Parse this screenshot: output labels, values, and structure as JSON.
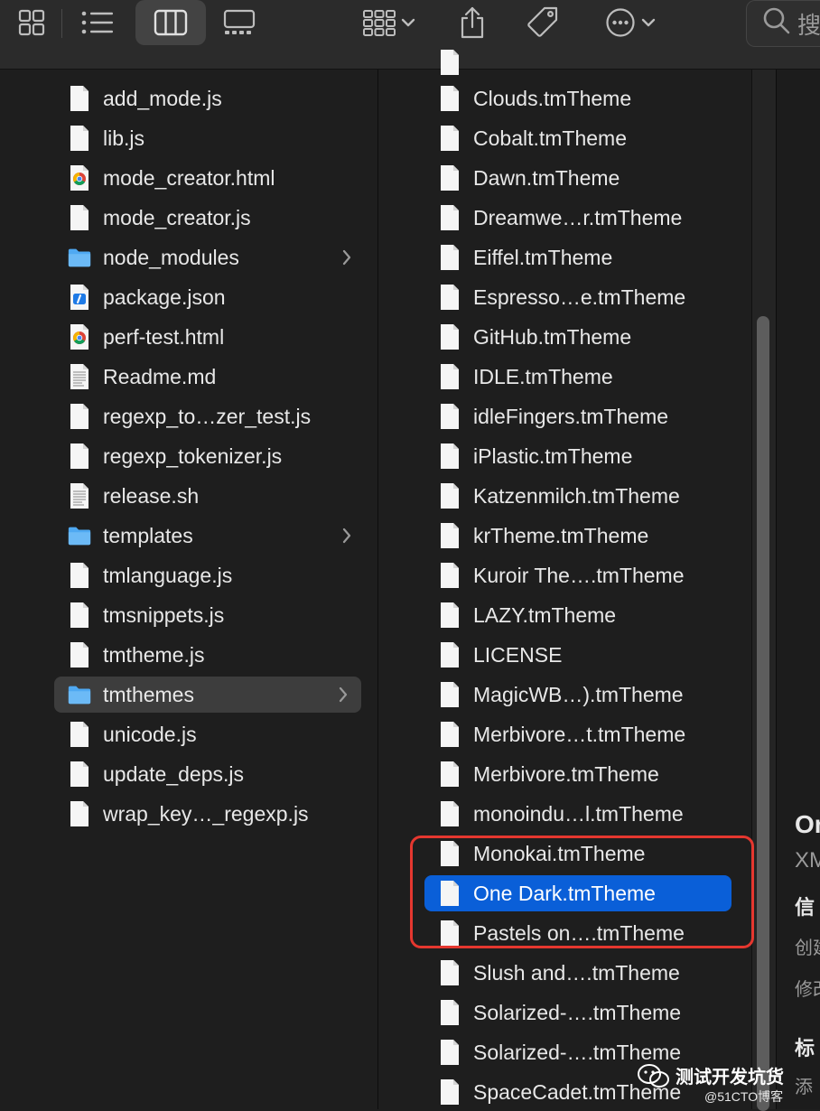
{
  "toolbar": {
    "buttons": [
      {
        "name": "icon-view-button",
        "icon": "grid-icon"
      },
      {
        "name": "list-view-button",
        "icon": "list-icon"
      },
      {
        "name": "column-view-button",
        "icon": "columns-icon",
        "selected": true
      },
      {
        "name": "gallery-view-button",
        "icon": "gallery-icon"
      },
      {
        "name": "group-button",
        "icon": "group-grid-icon"
      },
      {
        "name": "share-button",
        "icon": "share-icon"
      },
      {
        "name": "tags-button",
        "icon": "tag-icon"
      },
      {
        "name": "more-actions-button",
        "icon": "ellipsis-circle-icon"
      }
    ],
    "search_placeholder": "搜"
  },
  "column1": {
    "items": [
      {
        "label": "add_mode.js",
        "icon": "document-icon"
      },
      {
        "label": "lib.js",
        "icon": "document-icon"
      },
      {
        "label": "mode_creator.html",
        "icon": "chrome-html-icon"
      },
      {
        "label": "mode_creator.js",
        "icon": "document-icon"
      },
      {
        "label": "node_modules",
        "icon": "folder-icon",
        "folder": true
      },
      {
        "label": "package.json",
        "icon": "json-file-icon"
      },
      {
        "label": "perf-test.html",
        "icon": "chrome-html-icon"
      },
      {
        "label": "Readme.md",
        "icon": "text-document-icon"
      },
      {
        "label": "regexp_to…zer_test.js",
        "icon": "document-icon"
      },
      {
        "label": "regexp_tokenizer.js",
        "icon": "document-icon"
      },
      {
        "label": "release.sh",
        "icon": "text-document-icon"
      },
      {
        "label": "templates",
        "icon": "folder-icon",
        "folder": true
      },
      {
        "label": "tmlanguage.js",
        "icon": "document-icon"
      },
      {
        "label": "tmsnippets.js",
        "icon": "document-icon"
      },
      {
        "label": "tmtheme.js",
        "icon": "document-icon"
      },
      {
        "label": "tmthemes",
        "icon": "folder-icon",
        "folder": true,
        "selected": true
      },
      {
        "label": "unicode.js",
        "icon": "document-icon"
      },
      {
        "label": "update_deps.js",
        "icon": "document-icon"
      },
      {
        "label": "wrap_key…_regexp.js",
        "icon": "document-icon"
      }
    ]
  },
  "column2": {
    "items": [
      {
        "label": "Clouds.tmTheme"
      },
      {
        "label": "Cobalt.tmTheme"
      },
      {
        "label": "Dawn.tmTheme"
      },
      {
        "label": "Dreamwe…r.tmTheme"
      },
      {
        "label": "Eiffel.tmTheme"
      },
      {
        "label": "Espresso…e.tmTheme"
      },
      {
        "label": "GitHub.tmTheme"
      },
      {
        "label": "IDLE.tmTheme"
      },
      {
        "label": "idleFingers.tmTheme"
      },
      {
        "label": "iPlastic.tmTheme"
      },
      {
        "label": "Katzenmilch.tmTheme"
      },
      {
        "label": "krTheme.tmTheme"
      },
      {
        "label": "Kuroir The….tmTheme"
      },
      {
        "label": "LAZY.tmTheme"
      },
      {
        "label": "LICENSE"
      },
      {
        "label": "MagicWB…).tmTheme"
      },
      {
        "label": "Merbivore…t.tmTheme"
      },
      {
        "label": "Merbivore.tmTheme"
      },
      {
        "label": "monoindu…l.tmTheme"
      },
      {
        "label": "Monokai.tmTheme"
      },
      {
        "label": "One Dark.tmTheme",
        "selected": true
      },
      {
        "label": "Pastels on….tmTheme"
      },
      {
        "label": "Slush and….tmTheme"
      },
      {
        "label": "Solarized-….tmTheme"
      },
      {
        "label": "Solarized-….tmTheme"
      },
      {
        "label": "SpaceCadet.tmTheme"
      }
    ]
  },
  "preview": {
    "name_fragment": "On",
    "kind_fragment": "XM",
    "info_fragment": "信",
    "created_fragment": "创建",
    "modified_fragment": "修改",
    "tags_fragment": "标",
    "add_fragment": "添"
  },
  "watermark": {
    "line1": "测试开发坑货",
    "line2": "@51CTO博客"
  },
  "colors": {
    "selection_blue": "#0a5fd8",
    "selection_gray": "#3d3d3d",
    "folder_blue": "#4fa9f2",
    "highlight_red": "#e5372f",
    "background": "#1e1e1e"
  }
}
